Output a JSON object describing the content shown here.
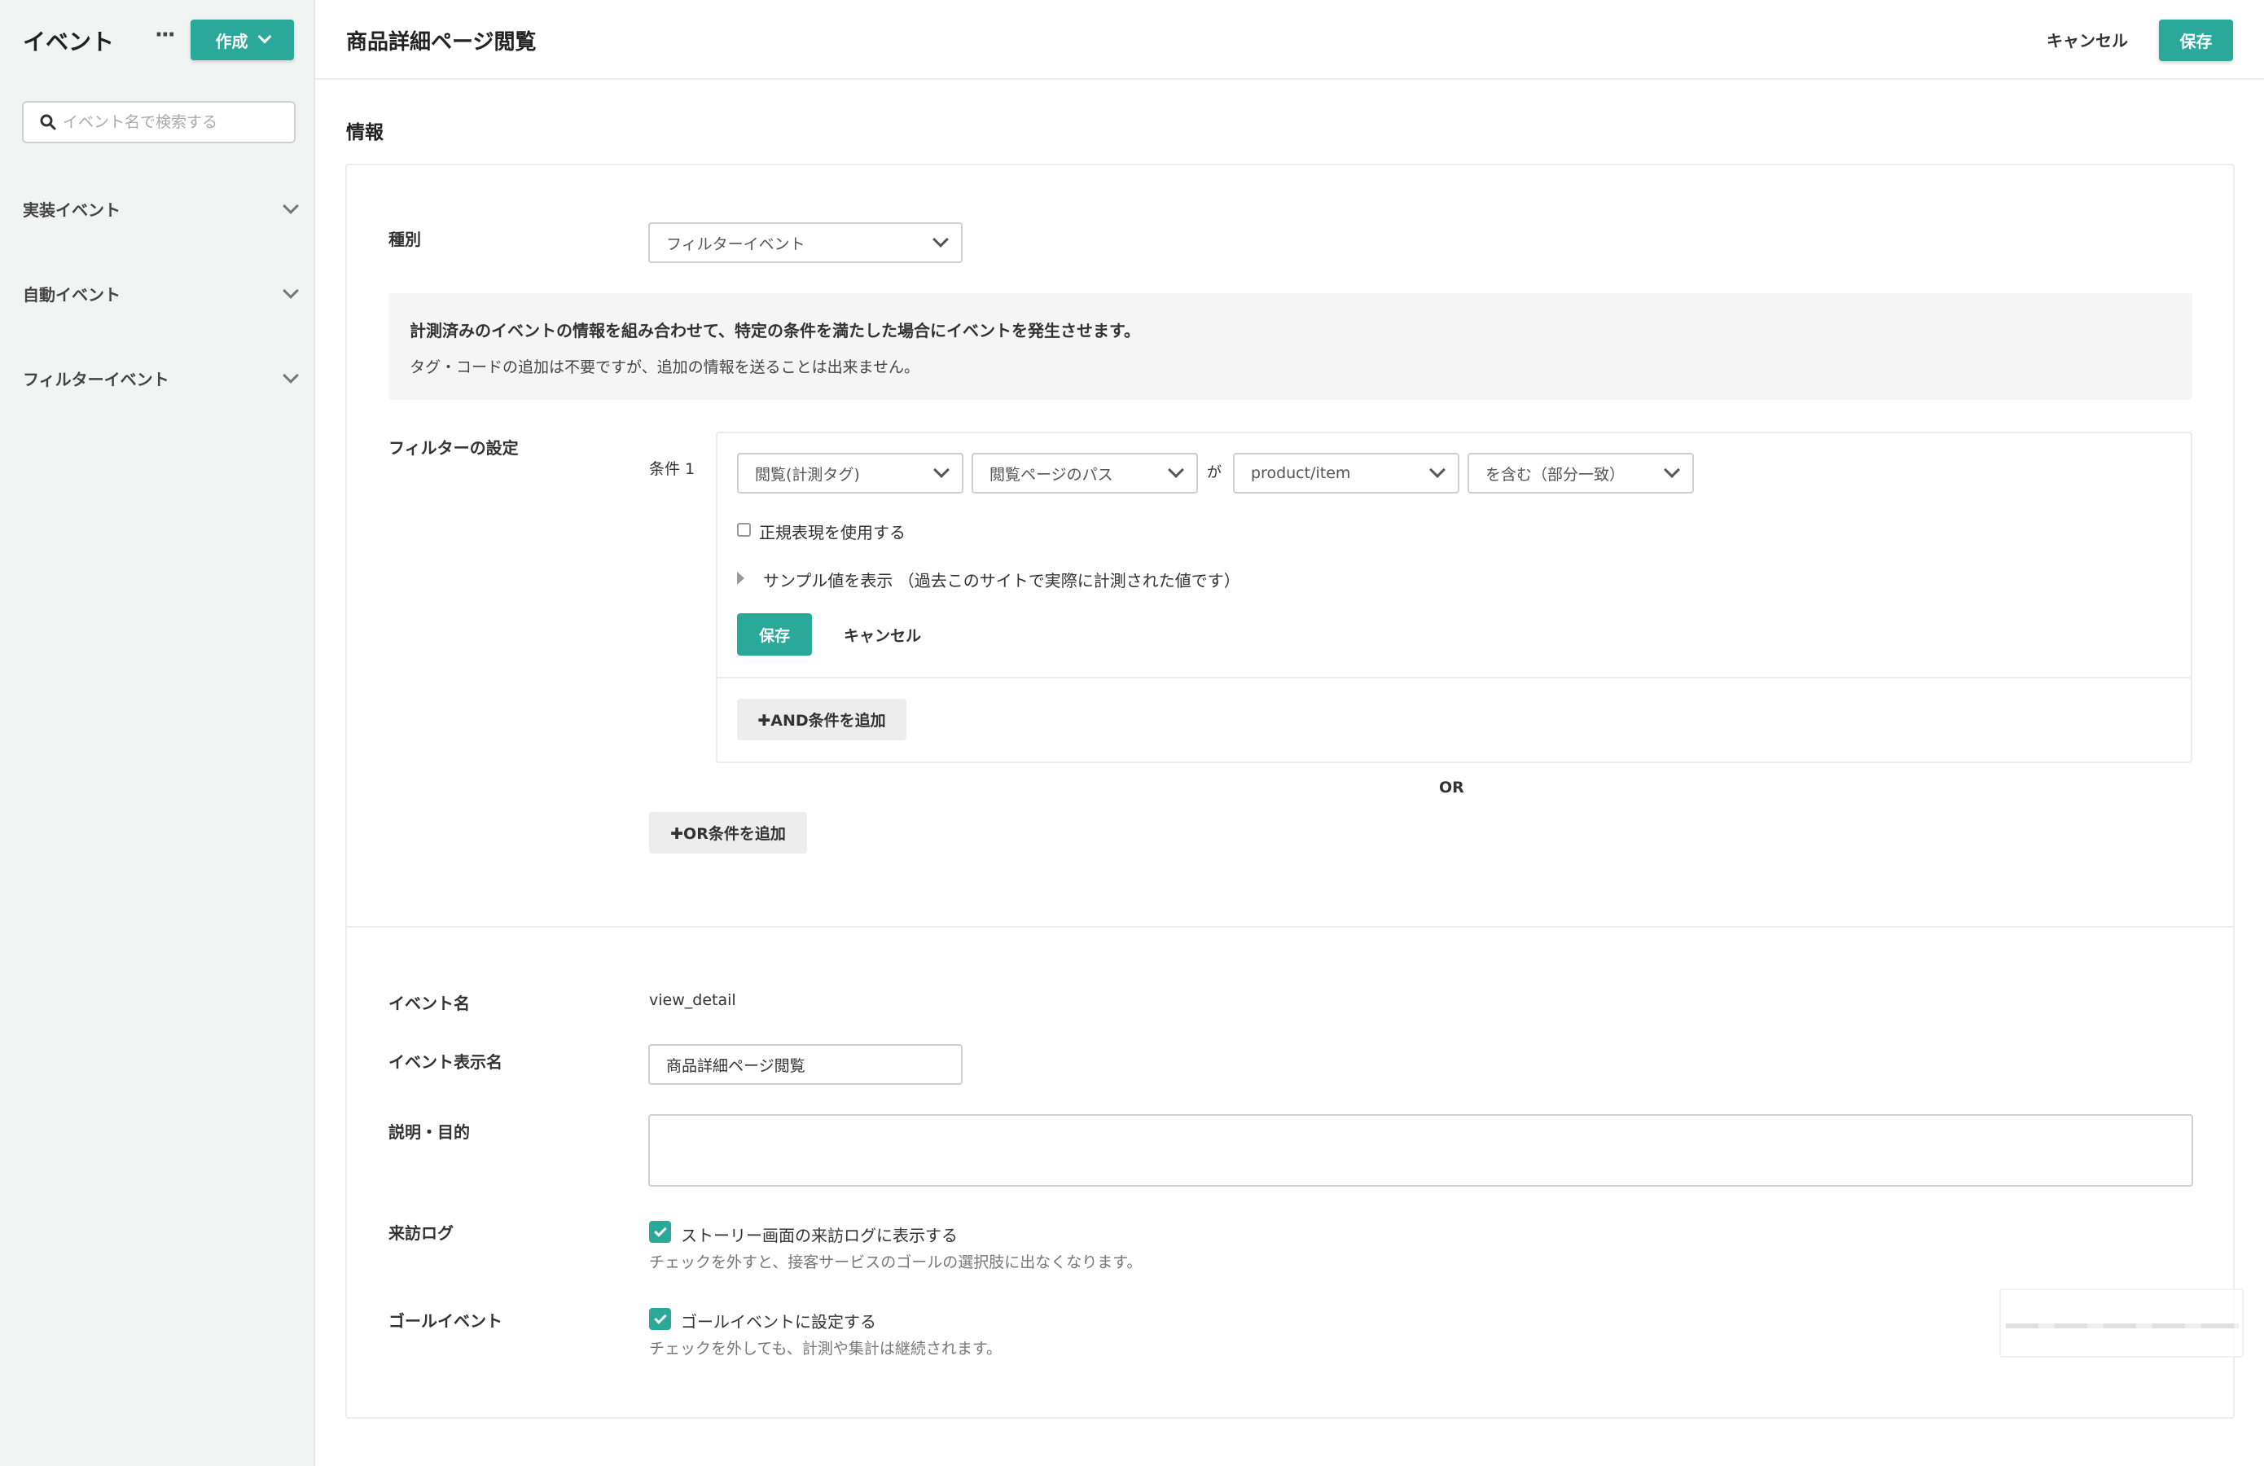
{
  "sidebar": {
    "title": "イベント",
    "more": "···",
    "create_label": "作成",
    "search_placeholder": "イベント名で検索する",
    "sections": [
      {
        "label": "実装イベント"
      },
      {
        "label": "自動イベント"
      },
      {
        "label": "フィルターイベント"
      }
    ]
  },
  "header": {
    "title": "商品詳細ページ閲覧",
    "cancel_label": "キャンセル",
    "save_label": "保存"
  },
  "info_section": {
    "title": "情報",
    "type_label": "種別",
    "type_value": "フィルターイベント",
    "notice_line1": "計測済みのイベントの情報を組み合わせて、特定の条件を満たした場合にイベントを発生させます。",
    "notice_line2": "タグ・コードの追加は不要ですが、追加の情報を送ることは出来ません。"
  },
  "filter": {
    "label": "フィルターの設定",
    "condition_label": "条件 1",
    "source_select": "閲覧(計測タグ)",
    "field_select": "閲覧ページのパス",
    "connector": "が",
    "value_select": "product/item",
    "match_select": "を含む（部分一致）",
    "regex_label": "正規表現を使用する",
    "sample_label": "サンプル値を表示 （過去このサイトで実際に計測された値です）",
    "save_label": "保存",
    "cancel_label": "キャンセル",
    "add_and_label": "✚AND条件を追加",
    "or_label": "OR",
    "add_or_label": "✚OR条件を追加"
  },
  "event": {
    "name_label": "イベント名",
    "name_value": "view_detail",
    "display_name_label": "イベント表示名",
    "display_name_value": "商品詳細ページ閲覧",
    "description_label": "説明・目的",
    "description_value": "",
    "visit_log_label": "来訪ログ",
    "visit_log_checkbox": "ストーリー画面の来訪ログに表示する",
    "visit_log_help": "チェックを外すと、接客サービスのゴールの選択肢に出なくなります。",
    "goal_label": "ゴールイベント",
    "goal_checkbox": "ゴールイベントに設定する",
    "goal_help": "チェックを外しても、計測や集計は継続されます。"
  },
  "colors": {
    "accent": "#2aa89a",
    "sidebar_bg": "#f2f3f3"
  }
}
